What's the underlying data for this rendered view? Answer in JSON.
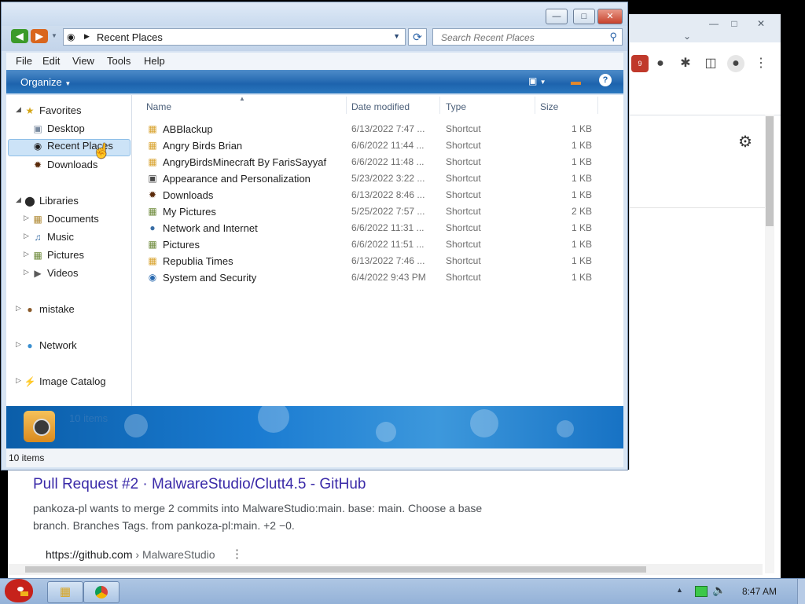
{
  "background_browser": {
    "extension_badge": "9",
    "result": {
      "title": "Pull Request #2 · MalwareStudio/Clutt4.5 - GitHub",
      "snippet": "pankoza-pl wants to merge 2 commits into MalwareStudio:main. base: main. Choose a base branch. Branches Tags. from pankoza-pl:main. +2 −0.",
      "url": "https://github.com",
      "url_path": "› MalwareStudio"
    }
  },
  "explorer": {
    "address_crumb": "Recent Places",
    "search_placeholder": "Search Recent Places",
    "menu": [
      "File",
      "Edit",
      "View",
      "Tools",
      "Help"
    ],
    "organize_label": "Organize",
    "nav": {
      "favorites": "Favorites",
      "desktop": "Desktop",
      "recent_places": "Recent Places",
      "downloads": "Downloads",
      "libraries": "Libraries",
      "documents": "Documents",
      "music": "Music",
      "pictures": "Pictures",
      "videos": "Videos",
      "mistake": "mistake",
      "network": "Network",
      "image_catalog": "Image Catalog"
    },
    "columns": [
      "Name",
      "Date modified",
      "Type",
      "Size"
    ],
    "files": [
      {
        "name": "ABBlackup",
        "date": "6/13/2022 7:47 ...",
        "type": "Shortcut",
        "size": "1 KB"
      },
      {
        "name": "Angry Birds Brian",
        "date": "6/6/2022 11:44 ...",
        "type": "Shortcut",
        "size": "1 KB"
      },
      {
        "name": "AngryBirdsMinecraft By FarisSayyaf",
        "date": "6/6/2022 11:48 ...",
        "type": "Shortcut",
        "size": "1 KB"
      },
      {
        "name": "Appearance and Personalization",
        "date": "5/23/2022 3:22 ...",
        "type": "Shortcut",
        "size": "1 KB"
      },
      {
        "name": "Downloads",
        "date": "6/13/2022 8:46 ...",
        "type": "Shortcut",
        "size": "1 KB"
      },
      {
        "name": "My Pictures",
        "date": "5/25/2022 7:57 ...",
        "type": "Shortcut",
        "size": "2 KB"
      },
      {
        "name": "Network and Internet",
        "date": "6/6/2022 11:31 ...",
        "type": "Shortcut",
        "size": "1 KB"
      },
      {
        "name": "Pictures",
        "date": "6/6/2022 11:51 ...",
        "type": "Shortcut",
        "size": "1 KB"
      },
      {
        "name": "Republia Times",
        "date": "6/13/2022 7:46 ...",
        "type": "Shortcut",
        "size": "1 KB"
      },
      {
        "name": "System and Security",
        "date": "6/4/2022 9:43 PM",
        "type": "Shortcut",
        "size": "1 KB"
      }
    ],
    "details_count": "10 items",
    "status_count": "10 items"
  },
  "taskbar": {
    "clock": "8:47 AM"
  },
  "colors": {
    "command_bar": "#1d63ad",
    "selection": "#cce3f7",
    "link_title": "#3a2aa8"
  }
}
